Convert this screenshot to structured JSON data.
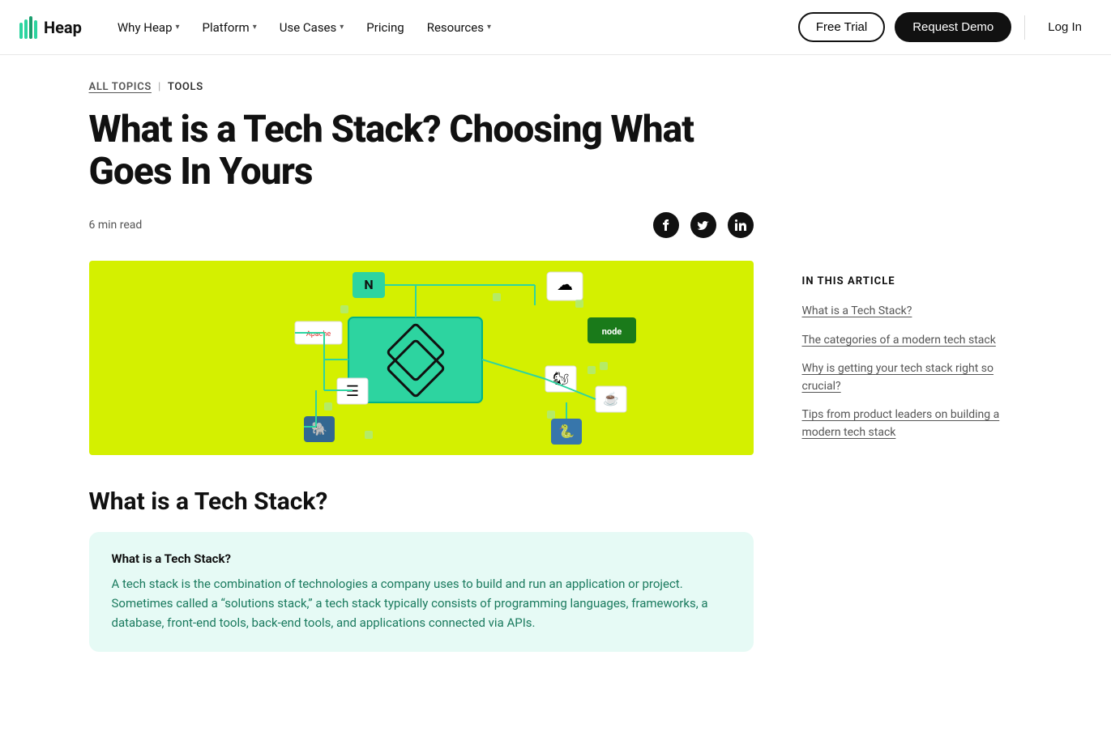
{
  "logo": {
    "text": "Heap"
  },
  "nav": {
    "items": [
      {
        "label": "Why Heap",
        "hasDropdown": true
      },
      {
        "label": "Platform",
        "hasDropdown": true
      },
      {
        "label": "Use Cases",
        "hasDropdown": true
      },
      {
        "label": "Pricing",
        "hasDropdown": false
      },
      {
        "label": "Resources",
        "hasDropdown": true
      }
    ],
    "free_trial": "Free Trial",
    "request_demo": "Request Demo",
    "login": "Log In"
  },
  "breadcrumb": {
    "all_topics": "ALL TOPICS",
    "separator": "|",
    "current": "TOOLS"
  },
  "article": {
    "title": "What is a Tech Stack? Choosing What Goes In Yours",
    "read_time": "6 min read",
    "section_heading": "What is a Tech Stack?",
    "callout_title": "What is a Tech Stack?",
    "callout_text": "A tech stack is the combination of technologies a company uses to build and run an application or project. Sometimes called a “solutions stack,” a tech stack typically consists of programming languages, frameworks, a database, front-end tools, back-end tools, and applications connected via APIs."
  },
  "social": {
    "facebook_label": "f",
    "twitter_label": "🐦",
    "linkedin_label": "in"
  },
  "sidebar": {
    "heading": "IN THIS ARTICLE",
    "toc": [
      {
        "label": "What is a Tech Stack?"
      },
      {
        "label": "The categories of a modern tech stack"
      },
      {
        "label": "Why is getting your tech stack right so crucial?"
      },
      {
        "label": "Tips from product leaders on building a modern tech stack"
      }
    ]
  }
}
